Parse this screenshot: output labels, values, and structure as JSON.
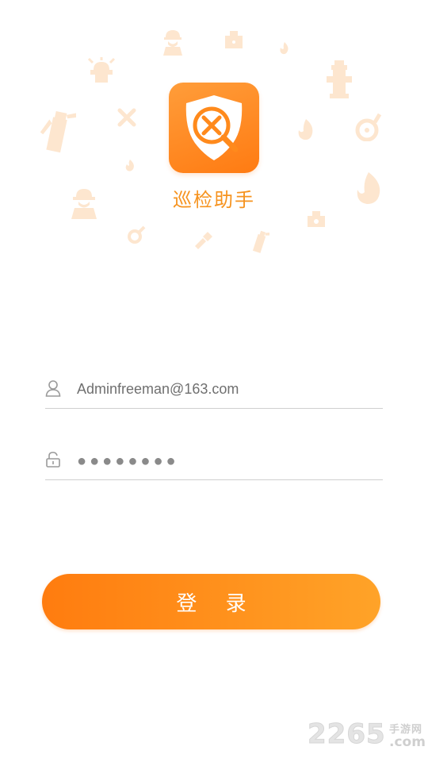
{
  "app": {
    "title": "巡检助手",
    "logo_icon": "shield-search-tools-icon",
    "accent_color": "#ff8a1c"
  },
  "background_icons": [
    "worker-icon",
    "alarm-device-icon",
    "fire-icon",
    "siren-icon",
    "hydrant-icon",
    "fire-extinguisher-icon",
    "crossed-tools-icon",
    "flame-icon",
    "water-valve-icon",
    "small-flame-icon",
    "large-flame-icon",
    "firefighter-icon",
    "key-icon",
    "flashlight-icon",
    "extinguisher-small-icon",
    "alarm-box-icon"
  ],
  "login_form": {
    "username": {
      "icon": "user-icon",
      "value": "Adminfreeman@163.com"
    },
    "password": {
      "icon": "lock-icon",
      "value": "●●●●●●●●"
    },
    "submit_label": "登 录"
  },
  "watermark": {
    "number": "2265",
    "site_text": "手游网",
    "domain": ".com"
  }
}
